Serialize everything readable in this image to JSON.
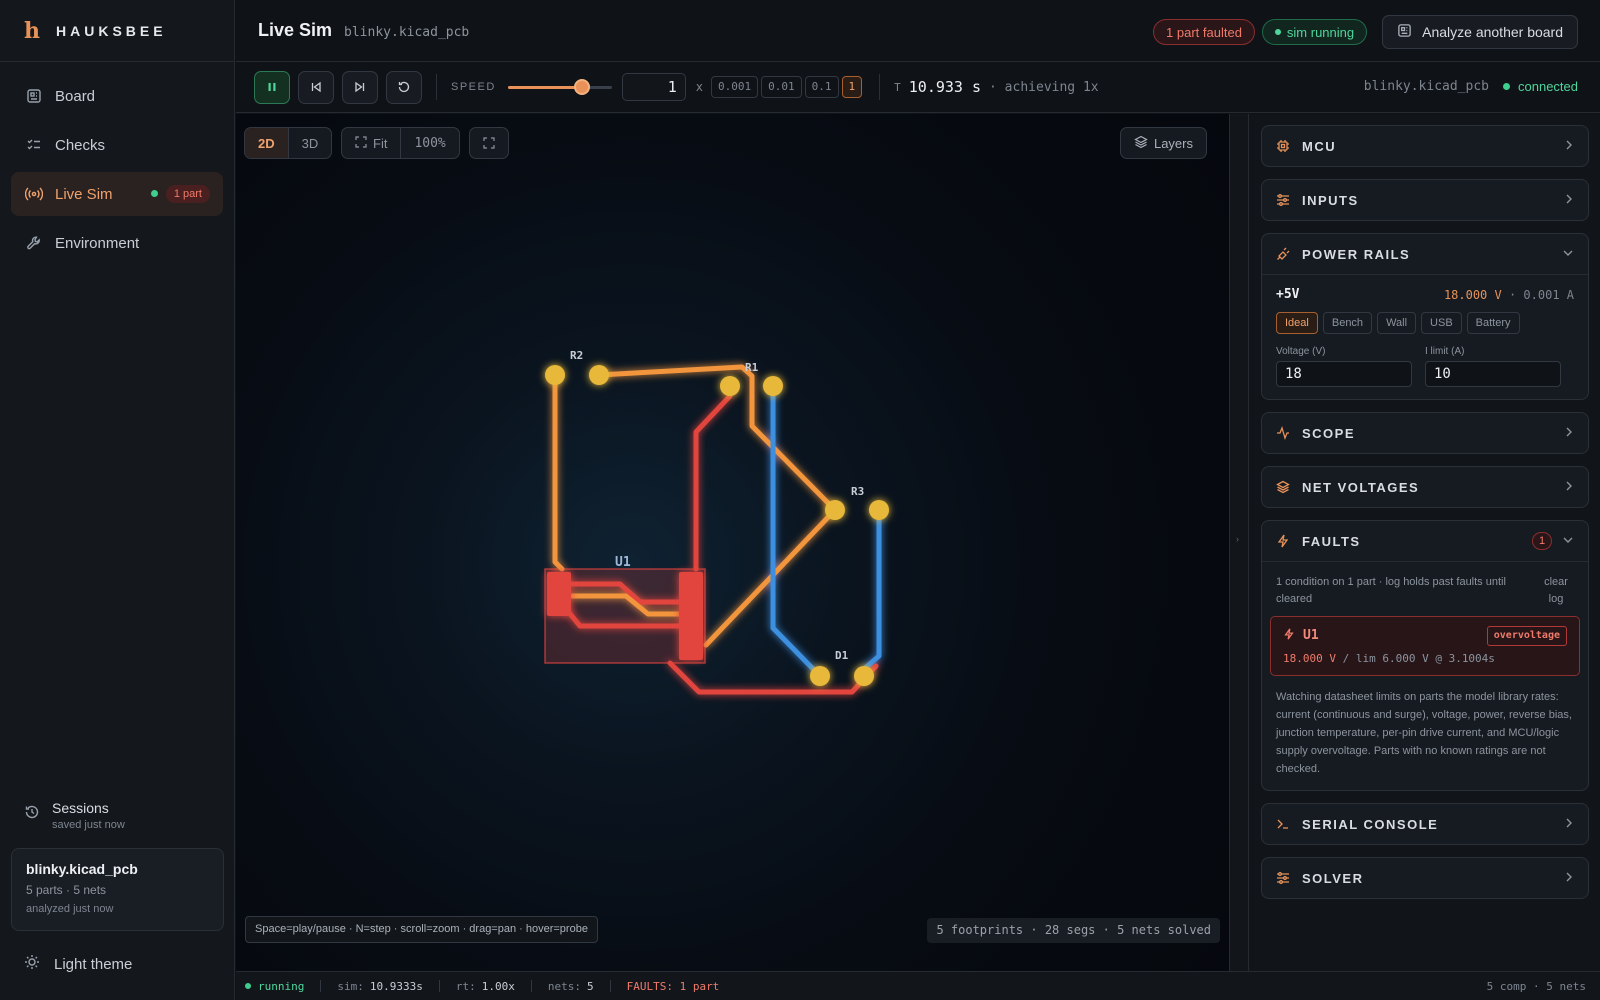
{
  "brand": {
    "name": "HAUKSBEE",
    "logo_letter": "h"
  },
  "sidebar": {
    "items": [
      {
        "label": "Board",
        "icon": "board-icon"
      },
      {
        "label": "Checks",
        "icon": "checklist-icon"
      },
      {
        "label": "Live Sim",
        "icon": "broadcast-icon",
        "badge": "1 part",
        "active": true
      },
      {
        "label": "Environment",
        "icon": "wrench-icon"
      }
    ],
    "sessions": {
      "title": "Sessions",
      "subtitle": "saved just now"
    },
    "session_card": {
      "name": "blinky.kicad_pcb",
      "meta": "5 parts · 5 nets",
      "time": "analyzed just now"
    },
    "theme_label": "Light theme"
  },
  "header": {
    "title": "Live Sim",
    "file": "blinky.kicad_pcb",
    "fault_pill": "1 part faulted",
    "status_pill": "sim running",
    "analyze_button": "Analyze another board"
  },
  "toolbar": {
    "speed_label": "SPEED",
    "speed_value": "1",
    "speed_slider_fraction": 0.71,
    "x_label": "x",
    "presets": [
      "0.001",
      "0.01",
      "0.1",
      "1"
    ],
    "active_preset": "1",
    "time_label": "T",
    "time_value": "10.933 s",
    "achieving": "· achieving 1x",
    "file": "blinky.kicad_pcb",
    "connection": "connected"
  },
  "canvas": {
    "view_2d": "2D",
    "view_3d": "3D",
    "fit_label": "Fit",
    "zoom": "100%",
    "layers_label": "Layers",
    "hint": "Space=play/pause · N=step · scroll=zoom · drag=pan · hover=probe",
    "stats": "5 footprints · 28 segs · 5 nets solved",
    "components": [
      {
        "ref": "R2"
      },
      {
        "ref": "R1"
      },
      {
        "ref": "R3"
      },
      {
        "ref": "U1"
      },
      {
        "ref": "D1"
      }
    ],
    "colors": {
      "faulted": "#e2453e",
      "power": "#f2953e",
      "signal": "#3d8fe0",
      "pad": "#e8b83a"
    }
  },
  "panel": {
    "sections": {
      "mcu": "MCU",
      "inputs": "INPUTS",
      "power_rails": "POWER RAILS",
      "scope": "SCOPE",
      "net_voltages": "NET VOLTAGES",
      "faults": "FAULTS",
      "serial_console": "SERIAL CONSOLE",
      "solver": "SOLVER"
    },
    "rail": {
      "name": "+5V",
      "voltage": "18.000 V",
      "current": "· 0.001 A",
      "sources": [
        "Ideal",
        "Bench",
        "Wall",
        "USB",
        "Battery"
      ],
      "active_source": "Ideal",
      "voltage_label": "Voltage (V)",
      "voltage_value": "18",
      "ilimit_label": "I limit (A)",
      "ilimit_value": "10"
    },
    "faults": {
      "count": "1",
      "note": "1 condition on 1 part · log holds past faults until cleared",
      "clear_label": "clear log",
      "item": {
        "part": "U1",
        "tag": "overvoltage",
        "value": "18.000 V",
        "detail": " / lim 6.000 V @ 3.1004s"
      },
      "description": "Watching datasheet limits on parts the model library rates: current (continuous and surge), voltage, power, reverse bias, junction temperature, per-pin drive current, and MCU/logic supply overvoltage. Parts with no known ratings are not checked."
    }
  },
  "statusbar": {
    "state": "running",
    "sim_label": "sim:",
    "sim_value": "10.9333s",
    "rt_label": "rt:",
    "rt_value": "1.00x",
    "nets_label": "nets:",
    "nets_value": "5",
    "faults": "FAULTS: 1 part",
    "right": "5 comp · 5 nets"
  }
}
